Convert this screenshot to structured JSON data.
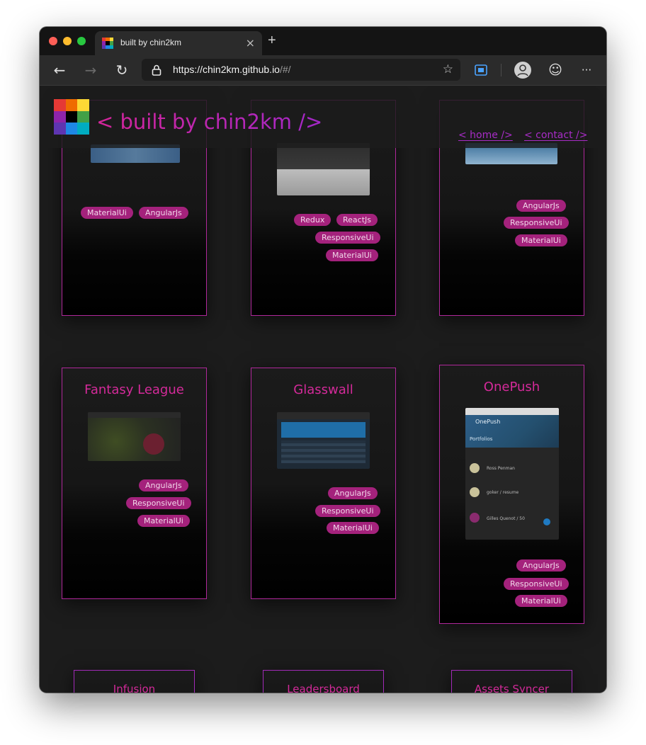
{
  "browser": {
    "tab_title": "built by chin2km",
    "tab_close": "×",
    "new_tab": "+",
    "url_host": "https://chin2km.github.io",
    "url_rest": "/#/",
    "back": "←",
    "forward": "→",
    "reload": "↻",
    "star": "☆",
    "emoji": "☺",
    "more": "···"
  },
  "site": {
    "brand": "< built by chin2km />",
    "nav": [
      {
        "label": "< home />"
      },
      {
        "label": "< contact />"
      }
    ]
  },
  "projects_row1": [
    {
      "tags": [
        "MaterialUi",
        "AngularJs"
      ]
    },
    {
      "tags": [
        "Redux",
        "ReactJs",
        "ResponsiveUi",
        "MaterialUi"
      ]
    },
    {
      "tags": [
        "AngularJs",
        "ResponsiveUi",
        "MaterialUi"
      ]
    }
  ],
  "projects_row2": [
    {
      "title": "Fantasy League",
      "tags": [
        "AngularJs",
        "ResponsiveUi",
        "MaterialUi"
      ]
    },
    {
      "title": "Glasswall",
      "tags": [
        "AngularJs",
        "ResponsiveUi",
        "MaterialUi"
      ]
    },
    {
      "title": "OnePush",
      "tags": [
        "AngularJs",
        "ResponsiveUi",
        "MaterialUi"
      ],
      "screenshot": {
        "app_name": "OnePush",
        "section": "Portfolios",
        "entries": [
          "Ross Penman",
          "goker / resume",
          "Gilles Quenot / 50"
        ]
      }
    }
  ],
  "projects_row3": [
    {
      "title": "Infusion"
    },
    {
      "title": "Leadersboard"
    },
    {
      "title": "Assets Syncer"
    }
  ],
  "colors": {
    "accent_pink": "#d42a9a",
    "accent_purple": "#a72cc6",
    "tag_bg": "#a4227c"
  }
}
